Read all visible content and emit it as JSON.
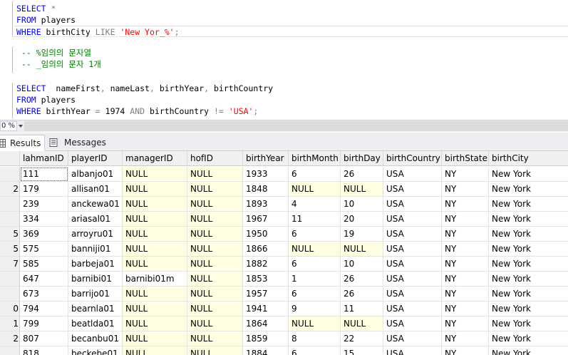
{
  "editor": {
    "lines": [
      [
        [
          "kw",
          "SELECT"
        ],
        [
          "op",
          " *"
        ]
      ],
      [
        [
          "kw",
          "FROM"
        ],
        [
          "id",
          " players"
        ]
      ],
      [
        [
          "kw",
          "WHERE"
        ],
        [
          "id",
          " birthCity "
        ],
        [
          "op",
          "LIKE"
        ],
        [
          "id",
          " "
        ],
        [
          "str",
          "'New Yor_%'"
        ],
        [
          "op",
          ";"
        ]
      ],
      [],
      [
        [
          "comment",
          " -- %임의의 문자열"
        ]
      ],
      [
        [
          "comment",
          " -- _임의의 문자 1개"
        ]
      ],
      [],
      [
        [
          "kw",
          "SELECT"
        ],
        [
          "id",
          "  nameFirst"
        ],
        [
          "op",
          ","
        ],
        [
          "id",
          " nameLast"
        ],
        [
          "op",
          ","
        ],
        [
          "id",
          " birthYear"
        ],
        [
          "op",
          ","
        ],
        [
          "id",
          " birthCountry"
        ]
      ],
      [
        [
          "kw",
          "FROM"
        ],
        [
          "id",
          " players"
        ]
      ],
      [
        [
          "kw",
          "WHERE"
        ],
        [
          "id",
          " birthYear "
        ],
        [
          "op",
          "="
        ],
        [
          "id",
          " 1974 "
        ],
        [
          "op",
          "AND"
        ],
        [
          "id",
          " birthCountry "
        ],
        [
          "op",
          "!="
        ],
        [
          "id",
          " "
        ],
        [
          "str",
          "'USA'"
        ],
        [
          "op",
          ";"
        ]
      ]
    ]
  },
  "zoom": {
    "value": "0 %"
  },
  "tabs": {
    "results_label": "Results",
    "messages_label": "Messages"
  },
  "colors": {
    "keyword": "#0000ff",
    "string": "#ff0000",
    "comment": "#008000",
    "operator": "#808080",
    "null_cell": "#ffffe1"
  },
  "grid": {
    "columns": [
      "lahmanID",
      "playerID",
      "managerID",
      "hofID",
      "birthYear",
      "birthMonth",
      "birthDay",
      "birthCountry",
      "birthState",
      "birthCity"
    ],
    "rows": [
      {
        "n": "",
        "cells": [
          "111",
          "albanjo01",
          "NULL",
          "NULL",
          "1933",
          "6",
          "26",
          "USA",
          "NY",
          "New York"
        ]
      },
      {
        "n": "2",
        "cells": [
          "179",
          "allisan01",
          "NULL",
          "NULL",
          "1848",
          "NULL",
          "NULL",
          "USA",
          "NY",
          "New York"
        ]
      },
      {
        "n": "",
        "cells": [
          "239",
          "anckewa01",
          "NULL",
          "NULL",
          "1893",
          "4",
          "10",
          "USA",
          "NY",
          "New York"
        ]
      },
      {
        "n": "",
        "cells": [
          "334",
          "ariasal01",
          "NULL",
          "NULL",
          "1967",
          "11",
          "20",
          "USA",
          "NY",
          "New York"
        ]
      },
      {
        "n": "5",
        "cells": [
          "369",
          "arroyru01",
          "NULL",
          "NULL",
          "1950",
          "6",
          "19",
          "USA",
          "NY",
          "New York"
        ]
      },
      {
        "n": "5",
        "cells": [
          "575",
          "banniji01",
          "NULL",
          "NULL",
          "1866",
          "NULL",
          "NULL",
          "USA",
          "NY",
          "New York"
        ]
      },
      {
        "n": "7",
        "cells": [
          "585",
          "barbeja01",
          "NULL",
          "NULL",
          "1882",
          "6",
          "10",
          "USA",
          "NY",
          "New York"
        ]
      },
      {
        "n": "",
        "cells": [
          "647",
          "barnibi01",
          "barnibi01m",
          "NULL",
          "1853",
          "1",
          "26",
          "USA",
          "NY",
          "New York"
        ]
      },
      {
        "n": "",
        "cells": [
          "673",
          "barrijo01",
          "NULL",
          "NULL",
          "1957",
          "6",
          "26",
          "USA",
          "NY",
          "New York"
        ]
      },
      {
        "n": "0",
        "cells": [
          "794",
          "bearnla01",
          "NULL",
          "NULL",
          "1941",
          "9",
          "11",
          "USA",
          "NY",
          "New York"
        ]
      },
      {
        "n": "1",
        "cells": [
          "799",
          "beatlda01",
          "NULL",
          "NULL",
          "1864",
          "NULL",
          "NULL",
          "USA",
          "NY",
          "New York"
        ]
      },
      {
        "n": "2",
        "cells": [
          "807",
          "becanbu01",
          "NULL",
          "NULL",
          "1859",
          "8",
          "22",
          "USA",
          "NY",
          "New York"
        ]
      },
      {
        "n": "",
        "cells": [
          "818",
          "beckebe01",
          "NULL",
          "NULL",
          "1884",
          "6",
          "15",
          "USA",
          "NY",
          "New York"
        ]
      }
    ]
  }
}
